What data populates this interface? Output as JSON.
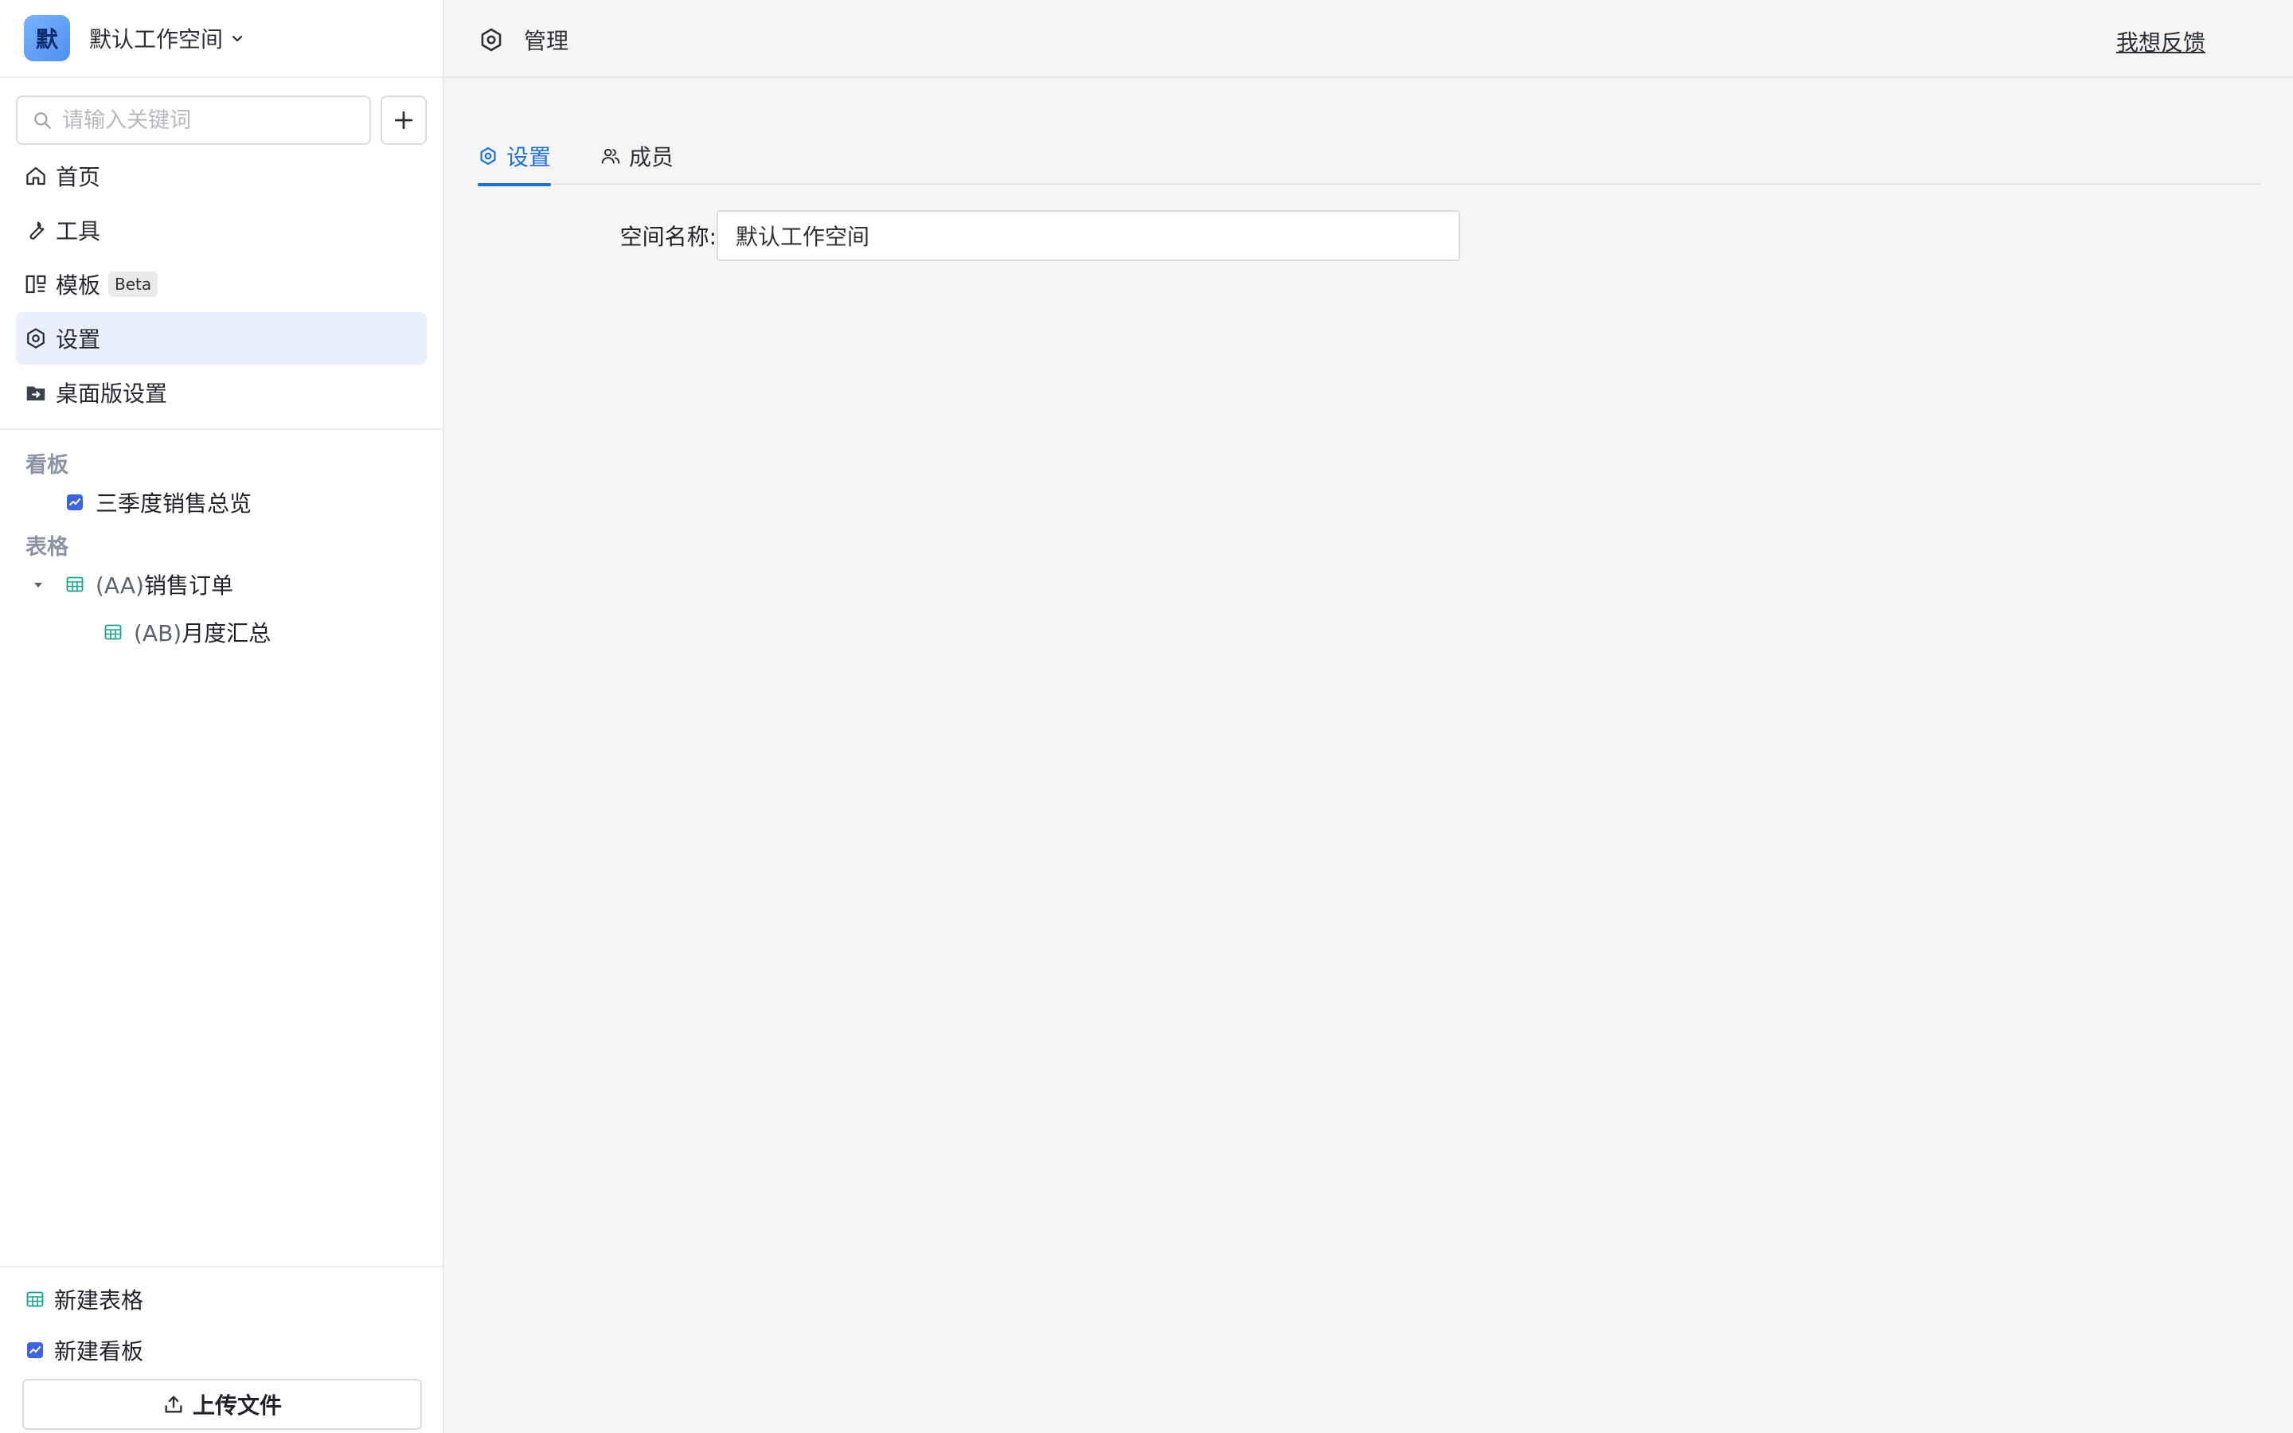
{
  "workspace": {
    "avatar_text": "默",
    "name": "默认工作空间"
  },
  "search": {
    "placeholder": "请输入关键词",
    "value": ""
  },
  "nav": {
    "items": [
      {
        "label": "首页",
        "icon": "home-icon"
      },
      {
        "label": "工具",
        "icon": "wrench-icon"
      },
      {
        "label": "模板",
        "icon": "template-icon",
        "badge": "Beta"
      },
      {
        "label": "设置",
        "icon": "gear-icon",
        "active": true
      },
      {
        "label": "桌面版设置",
        "icon": "folder-arrow-icon"
      }
    ]
  },
  "sections": {
    "dashboards": {
      "title": "看板",
      "items": [
        {
          "label": "三季度销售总览",
          "icon": "chart-icon"
        }
      ]
    },
    "tables": {
      "title": "表格",
      "items": [
        {
          "prefix": "(AA)",
          "label": "销售订单",
          "icon": "table-icon",
          "expanded": true,
          "children": [
            {
              "prefix": "(AB)",
              "label": "月度汇总",
              "icon": "table-icon"
            }
          ]
        }
      ]
    }
  },
  "footer": {
    "new_table": "新建表格",
    "new_dashboard": "新建看板",
    "upload": "上传文件"
  },
  "header": {
    "title": "管理",
    "feedback": "我想反馈"
  },
  "tabs": [
    {
      "label": "设置",
      "icon": "gear-icon",
      "active": true
    },
    {
      "label": "成员",
      "icon": "users-icon",
      "active": false
    }
  ],
  "form": {
    "space_name_label": "空间名称:",
    "space_name_value": "默认工作空间"
  },
  "colors": {
    "accent": "#1e6fd9",
    "active_bg": "#e9f0fc",
    "section_title": "#8a94a6"
  }
}
